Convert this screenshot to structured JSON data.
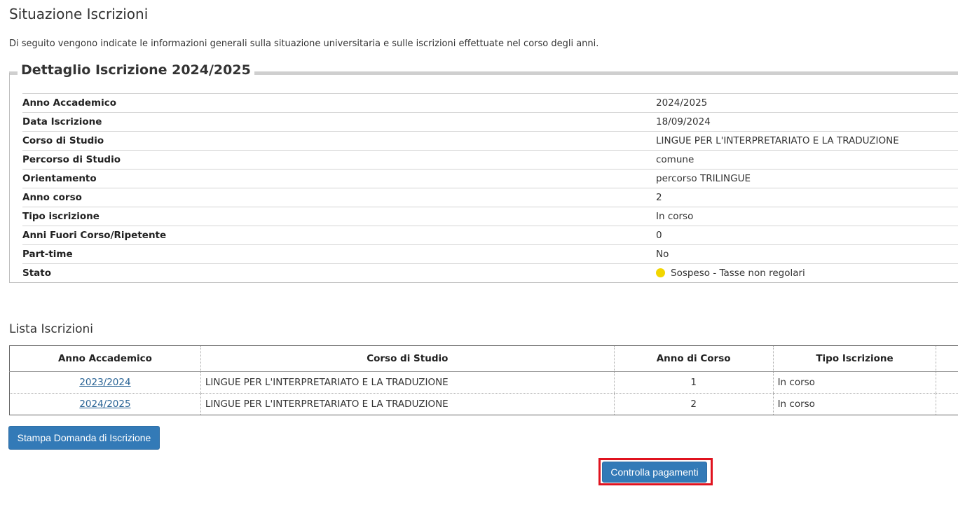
{
  "page": {
    "title": "Situazione Iscrizioni",
    "intro": "Di seguito vengono indicate le informazioni generali sulla situazione universitaria e sulle iscrizioni effettuate nel corso degli anni."
  },
  "detail": {
    "legend": "Dettaglio Iscrizione 2024/2025",
    "rows": [
      {
        "label": "Anno Accademico",
        "value": "2024/2025"
      },
      {
        "label": "Data Iscrizione",
        "value": "18/09/2024"
      },
      {
        "label": "Corso di Studio",
        "value": "LINGUE PER L'INTERPRETARIATO E LA TRADUZIONE"
      },
      {
        "label": "Percorso di Studio",
        "value": "comune"
      },
      {
        "label": "Orientamento",
        "value": "percorso TRILINGUE"
      },
      {
        "label": "Anno corso",
        "value": "2"
      },
      {
        "label": "Tipo iscrizione",
        "value": "In corso"
      },
      {
        "label": "Anni Fuori Corso/Ripetente",
        "value": "0"
      },
      {
        "label": "Part-time",
        "value": "No"
      },
      {
        "label": "Stato",
        "value": "Sospeso - Tasse non regolari"
      }
    ],
    "status_color": "#f2d600"
  },
  "list": {
    "title": "Lista Iscrizioni",
    "headers": [
      "Anno Accademico",
      "Corso di Studio",
      "Anno di Corso",
      "Tipo Iscrizione"
    ],
    "rows": [
      {
        "anno": "2023/2024",
        "corso": "LINGUE PER L'INTERPRETARIATO E LA TRADUZIONE",
        "anno_corso": "1",
        "tipo": "In corso"
      },
      {
        "anno": "2024/2025",
        "corso": "LINGUE PER L'INTERPRETARIATO E LA TRADUZIONE",
        "anno_corso": "2",
        "tipo": "In corso"
      }
    ]
  },
  "buttons": {
    "print": "Stampa Domanda di Iscrizione",
    "payments": "Controlla pagamenti"
  },
  "colors": {
    "button": "#337ab7",
    "highlight": "#e0131f",
    "link": "#2a6496"
  }
}
